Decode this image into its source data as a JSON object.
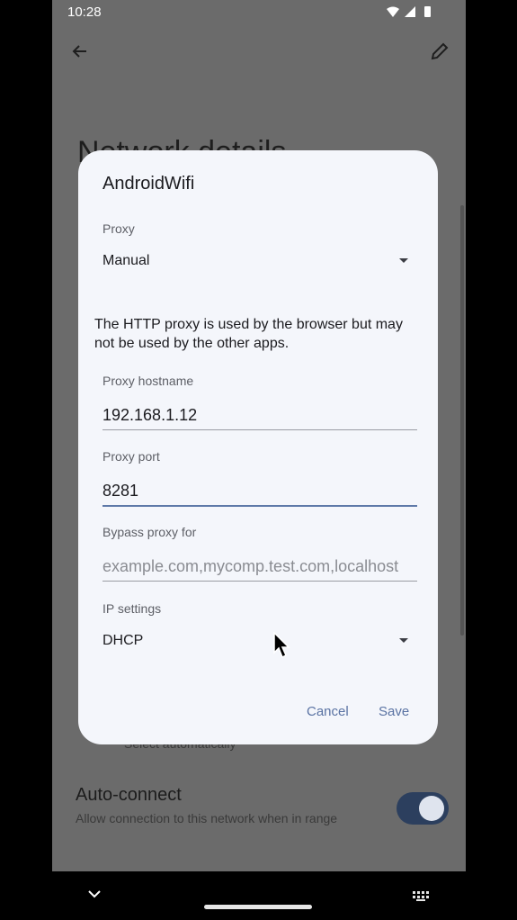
{
  "status_bar": {
    "time": "10:28"
  },
  "background": {
    "title": "Network details",
    "partial_row_text": "Select automatically",
    "auto_connect": {
      "title": "Auto-connect",
      "subtitle": "Allow connection to this network when in range",
      "enabled": true
    }
  },
  "dialog": {
    "title": "AndroidWifi",
    "proxy": {
      "label": "Proxy",
      "value": "Manual"
    },
    "info": "The HTTP proxy is used by the browser but may not be used by the other apps.",
    "hostname": {
      "label": "Proxy hostname",
      "value": "192.168.1.12"
    },
    "port": {
      "label": "Proxy port",
      "value": "8281"
    },
    "bypass": {
      "label": "Bypass proxy for",
      "placeholder": "example.com,mycomp.test.com,localhost"
    },
    "ip_settings": {
      "label": "IP settings",
      "value": "DHCP"
    },
    "buttons": {
      "cancel": "Cancel",
      "save": "Save"
    }
  },
  "colors": {
    "accent": "#5a73a3",
    "dialog_bg": "#f4f6fb",
    "scrim": "#6b6b6b",
    "toggle": "#2c3f5e"
  }
}
